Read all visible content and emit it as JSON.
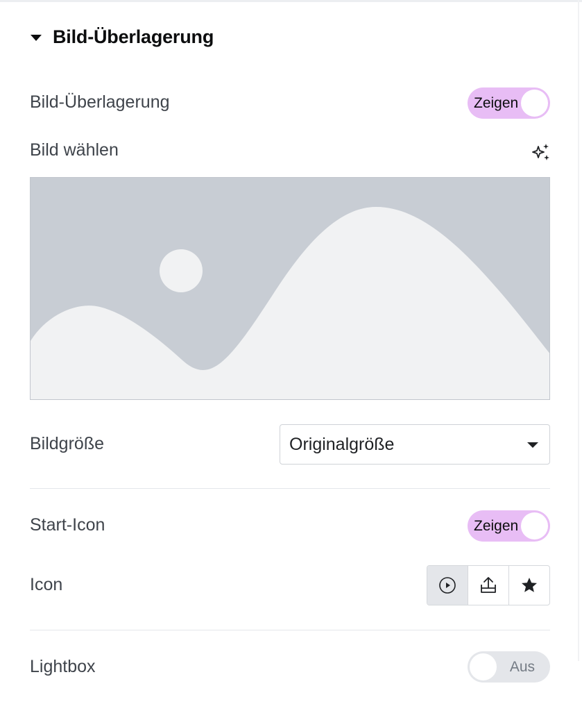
{
  "section": {
    "title": "Bild-Überlagerung"
  },
  "overlay_toggle": {
    "label": "Bild-Überlagerung",
    "state_text": "Zeigen"
  },
  "image_choose": {
    "label": "Bild wählen",
    "ai_icon": "sparkle-icon"
  },
  "image_size": {
    "label": "Bildgröße",
    "selected": "Originalgröße"
  },
  "start_icon": {
    "label": "Start-Icon",
    "state_text": "Zeigen"
  },
  "icon_picker": {
    "label": "Icon",
    "options": [
      "play-circle-icon",
      "upload-icon",
      "star-icon"
    ],
    "selected": "play-circle-icon"
  },
  "lightbox": {
    "label": "Lightbox",
    "state_text": "Aus"
  },
  "colors": {
    "toggle_on": "#e8bdf5",
    "toggle_off": "#e4e6ea",
    "placeholder_sky": "#c8cdd4",
    "placeholder_shapes": "#f1f2f3"
  }
}
